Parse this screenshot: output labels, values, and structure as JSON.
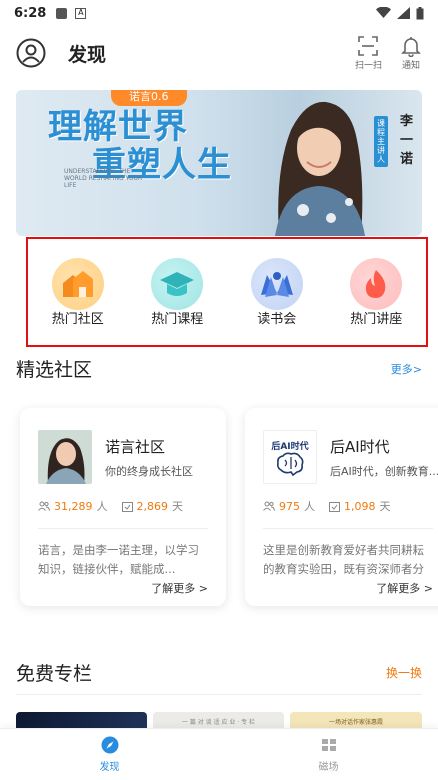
{
  "status_bar": {
    "time": "6:28",
    "a_label": "A"
  },
  "header": {
    "title": "发现",
    "scan_label": "扫一扫",
    "notify_label": "通知"
  },
  "banner": {
    "tag": "诺言0.6",
    "title_line1": "理解世界",
    "title_line2": "重塑人生",
    "subtitle": "UNDERSTANDING THE WORLD RESHAPING YOUR LIFE",
    "badge": "课程主讲人",
    "name": "李一诺"
  },
  "categories": [
    {
      "label": "热门社区",
      "icon": "house-icon"
    },
    {
      "label": "热门课程",
      "icon": "graduation-cap-icon"
    },
    {
      "label": "读书会",
      "icon": "book-icon"
    },
    {
      "label": "热门讲座",
      "icon": "flame-icon"
    }
  ],
  "featured": {
    "title": "精选社区",
    "more": "更多>"
  },
  "cards": [
    {
      "name": "诺言社区",
      "desc": "你的终身成长社区",
      "members": "31,289",
      "members_unit": "人",
      "days": "2,869",
      "days_unit": "天",
      "intro": "诺言，是由李一诺主理，以学习知识，链接伙伴，赋能成...",
      "more": "了解更多 >"
    },
    {
      "name": "后AI时代",
      "logo_text": "后AI时代",
      "desc": "后AI时代，创新教育...",
      "members": "975",
      "members_unit": "人",
      "days": "1,098",
      "days_unit": "天",
      "intro": "这里是创新教育爱好者共同耕耘的教育实验田，既有资深师者分享课堂教育智慧，也有...",
      "more": "了解更多 >"
    }
  ],
  "free": {
    "title": "免费专栏",
    "refresh": "换一换",
    "thumb2_text": "一 篇 对 谈 适 应 业 · 专 栏",
    "thumb3_text": "一场对话作家张惠霞"
  },
  "bottom_nav": [
    {
      "label": "发现",
      "active": true
    },
    {
      "label": "磁场",
      "active": false
    }
  ],
  "colors": {
    "accent": "#2a8ce0",
    "orange": "#f07a10",
    "highlight_border": "#e01010"
  }
}
